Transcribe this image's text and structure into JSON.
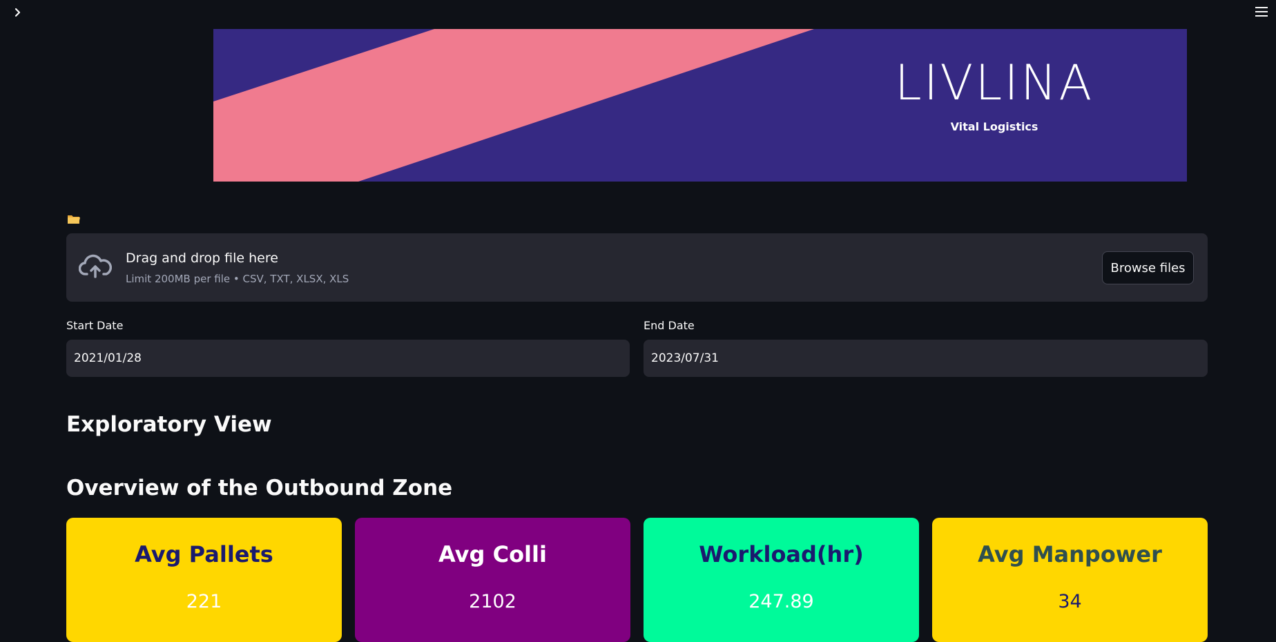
{
  "app": {
    "sidebar_toggle_icon": "chevron-right-icon",
    "menu_icon": "hamburger-menu-icon"
  },
  "banner": {
    "logo_text": "LIVLINA",
    "tagline": "Vital Logistics",
    "colors": {
      "background": "#362983",
      "stripe": "#f07b8f"
    }
  },
  "uploader": {
    "label_icon": "folder-icon",
    "title": "Drag and drop file here",
    "subtitle": "Limit 200MB per file • CSV, TXT, XLSX, XLS",
    "browse_label": "Browse files"
  },
  "dates": {
    "start_label": "Start Date",
    "start_value": "2021/01/28",
    "end_label": "End Date",
    "end_value": "2023/07/31"
  },
  "headings": {
    "exploratory": "Exploratory View",
    "outbound": "Overview of the Outbound Zone"
  },
  "kpis": [
    {
      "title": "Avg Pallets",
      "value": "221",
      "bg": "#ffd700",
      "title_color": "#1a1a6e",
      "value_color": "#ffffff"
    },
    {
      "title": "Avg Colli",
      "value": "2102",
      "bg": "#800080",
      "title_color": "#ffffff",
      "value_color": "#ffffff"
    },
    {
      "title": "Workload(hr)",
      "value": "247.89",
      "bg": "#00fa9a",
      "title_color": "#1a1a6e",
      "value_color": "#ffffff"
    },
    {
      "title": "Avg Manpower",
      "value": "34",
      "bg": "#ffd700",
      "title_color": "#2f4f4f",
      "value_color": "#1a1a6e"
    }
  ]
}
